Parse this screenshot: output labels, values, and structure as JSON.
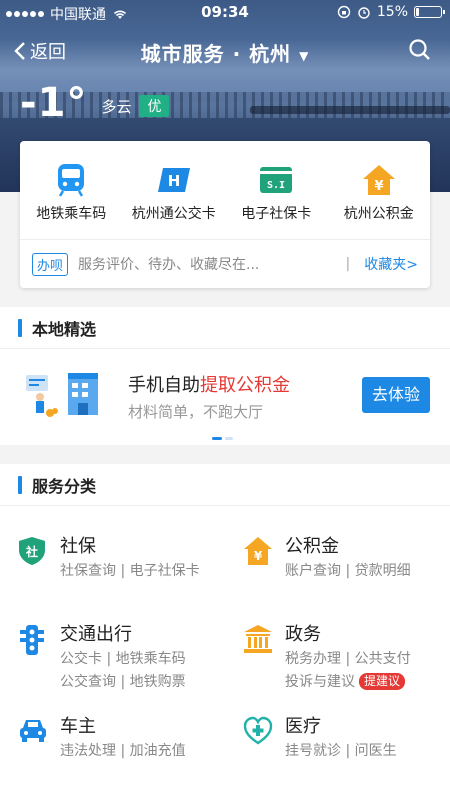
{
  "statusbar": {
    "carrier": "中国联通",
    "time": "09:34",
    "battery": "15%",
    "battery_level": 0.15
  },
  "navbar": {
    "back_label": "返回",
    "title": "城市服务 · 杭州"
  },
  "weather": {
    "temperature": "-1°",
    "condition": "多云",
    "aqi": "优"
  },
  "quick": {
    "items": [
      {
        "label": "地铁乘车码",
        "icon": "metro-icon",
        "color": "#2196f3"
      },
      {
        "label": "杭州通公交卡",
        "icon": "bus-card-h-icon",
        "color": "#1e88e5"
      },
      {
        "label": "电子社保卡",
        "icon": "social-security-card-icon",
        "color": "#20a37a"
      },
      {
        "label": "杭州公积金",
        "icon": "housing-fund-icon",
        "color": "#f5a623"
      }
    ],
    "banshi_tag": "办呗",
    "description": "服务评价、待办、收藏尽在...",
    "separator": "|",
    "favorites": "收藏夹>"
  },
  "local": {
    "heading": "本地精选",
    "promo_title_prefix": "手机自助",
    "promo_title_highlight": "提取公积金",
    "promo_subtitle": "材料简单，不跑大厅",
    "promo_button": "去体验"
  },
  "services": {
    "heading": "服务分类",
    "items": [
      {
        "name": "社保",
        "links": [
          "社保查询 | 电子社保卡"
        ],
        "icon": "shield-icon",
        "color": "#20a37a"
      },
      {
        "name": "公积金",
        "links": [
          "账户查询 | 贷款明细"
        ],
        "icon": "house-yen-icon",
        "color": "#f5a623"
      },
      {
        "name": "交通出行",
        "links": [
          "公交卡 | 地铁乘车码",
          "公交查询 | 地铁购票"
        ],
        "icon": "traffic-light-icon",
        "color": "#1e88e5"
      },
      {
        "name": "政务",
        "links": [
          "税务办理 | 公共支付",
          "投诉与建议"
        ],
        "badge": "提建议",
        "icon": "government-building-icon",
        "color": "#f5a623"
      },
      {
        "name": "车主",
        "links": [
          "违法处理 | 加油充值"
        ],
        "icon": "car-icon",
        "color": "#1e88e5"
      },
      {
        "name": "医疗",
        "links": [
          "挂号就诊 | 问医生"
        ],
        "icon": "medical-cross-icon",
        "color": "#20b2aa"
      }
    ]
  }
}
